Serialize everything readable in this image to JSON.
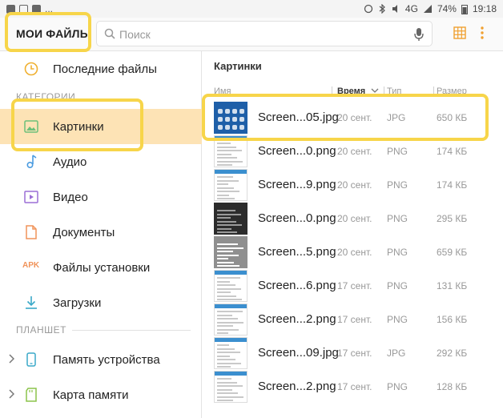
{
  "status_bar": {
    "time": "19:18",
    "battery": "74%",
    "network": "4G",
    "left_more": "..."
  },
  "app": {
    "title": "МОИ ФАЙЛЫ",
    "search_placeholder": "Поиск",
    "icons": {
      "search": "search-icon",
      "mic": "microphone-icon",
      "view": "grid-view-icon",
      "more": "more-vert-icon"
    },
    "highlight_color": "#f7d54a",
    "selected_color": "#fde3b5"
  },
  "sidebar": {
    "recent": "Последние файлы",
    "categories_header": "КАТЕГОРИИ",
    "categories": [
      {
        "label": "Картинки",
        "icon": "image-icon",
        "color": "#6cc07a"
      },
      {
        "label": "Аудио",
        "icon": "music-note-icon",
        "color": "#4a9be0"
      },
      {
        "label": "Видео",
        "icon": "video-icon",
        "color": "#9b6fd6"
      },
      {
        "label": "Документы",
        "icon": "document-icon",
        "color": "#f0935a"
      },
      {
        "label": "Файлы установки",
        "icon": "apk-icon",
        "icon_text": "APK",
        "color": "#f0935a"
      },
      {
        "label": "Загрузки",
        "icon": "download-icon",
        "color": "#3aa9c8"
      }
    ],
    "storage_header": "ПЛАНШЕТ",
    "storage": [
      {
        "label": "Память устройства",
        "icon": "phone-storage-icon",
        "color": "#3aa9c8"
      },
      {
        "label": "Карта памяти",
        "icon": "sd-card-icon",
        "color": "#8bc34a"
      }
    ]
  },
  "content": {
    "title": "Картинки",
    "columns": {
      "name": "Имя",
      "time": "Время",
      "type": "Тип",
      "size": "Размер"
    },
    "files": [
      {
        "name": "Screen...05.jpg",
        "date": "20 сент.",
        "type": "JPG",
        "size": "650 КБ",
        "thumb": "blue"
      },
      {
        "name": "Screen...0.png",
        "date": "20 сент.",
        "type": "PNG",
        "size": "174 КБ",
        "thumb": "light"
      },
      {
        "name": "Screen...9.png",
        "date": "20 сент.",
        "type": "PNG",
        "size": "174 КБ",
        "thumb": "light"
      },
      {
        "name": "Screen...0.png",
        "date": "20 сент.",
        "type": "PNG",
        "size": "295 КБ",
        "thumb": "dark"
      },
      {
        "name": "Screen...5.png",
        "date": "20 сент.",
        "type": "PNG",
        "size": "659 КБ",
        "thumb": "gray"
      },
      {
        "name": "Screen...6.png",
        "date": "17 сент.",
        "type": "PNG",
        "size": "131 КБ",
        "thumb": "light"
      },
      {
        "name": "Screen...2.png",
        "date": "17 сент.",
        "type": "PNG",
        "size": "156 КБ",
        "thumb": "light"
      },
      {
        "name": "Screen...09.jpg",
        "date": "17 сент.",
        "type": "JPG",
        "size": "292 КБ",
        "thumb": "light"
      },
      {
        "name": "Screen...2.png",
        "date": "17 сент.",
        "type": "PNG",
        "size": "128 КБ",
        "thumb": "light"
      }
    ]
  }
}
